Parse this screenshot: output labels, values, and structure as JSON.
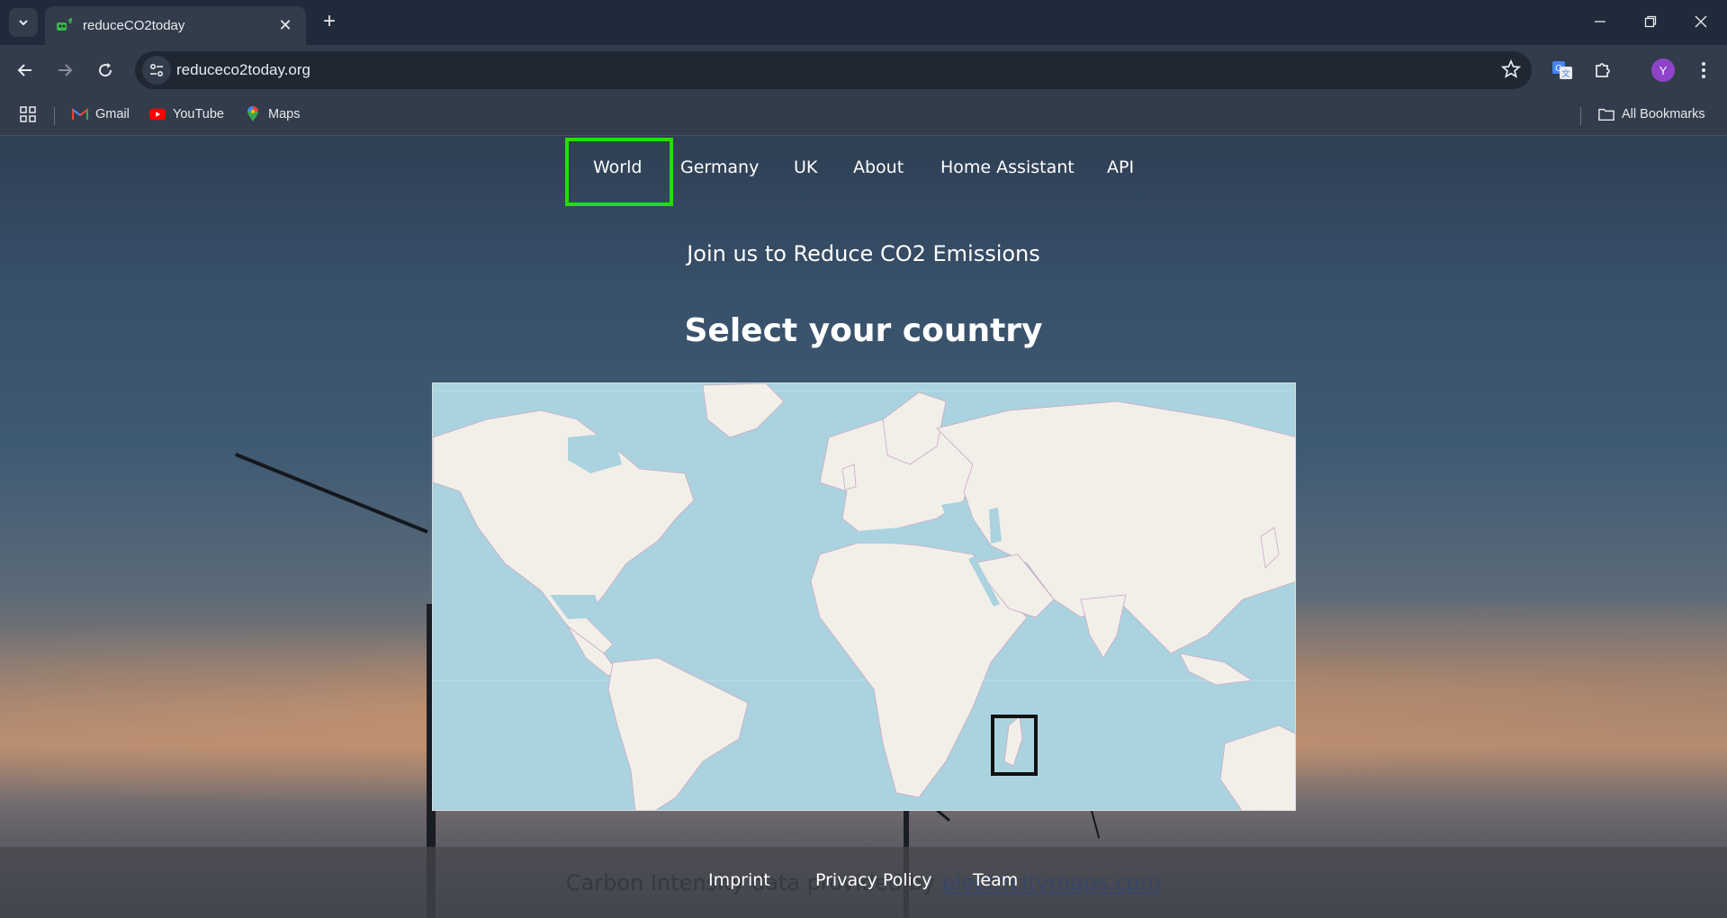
{
  "browser": {
    "tab_title": "reduceCO2today",
    "url": "reduceco2today.org",
    "profile_initial": "Y",
    "bookmarks": [
      {
        "label": "Gmail",
        "icon": "gmail-icon"
      },
      {
        "label": "YouTube",
        "icon": "youtube-icon"
      },
      {
        "label": "Maps",
        "icon": "maps-icon"
      }
    ],
    "all_bookmarks_label": "All Bookmarks"
  },
  "nav": {
    "items": [
      "World",
      "Germany",
      "UK",
      "About",
      "Home Assistant",
      "API"
    ],
    "active": "World",
    "active_color": "#22dd11"
  },
  "hero": {
    "tagline": "Join us to Reduce CO2 Emissions",
    "heading": "Select your country"
  },
  "map": {
    "water_color": "#aad3df",
    "land_color": "#f2efe9",
    "highlighted_region": "Madagascar"
  },
  "footer": {
    "links": [
      "Imprint",
      "Privacy Policy",
      "Team"
    ],
    "ghost_text": "Carbon Intensity data provided by",
    "ghost_link": "electricitymaps.com"
  }
}
